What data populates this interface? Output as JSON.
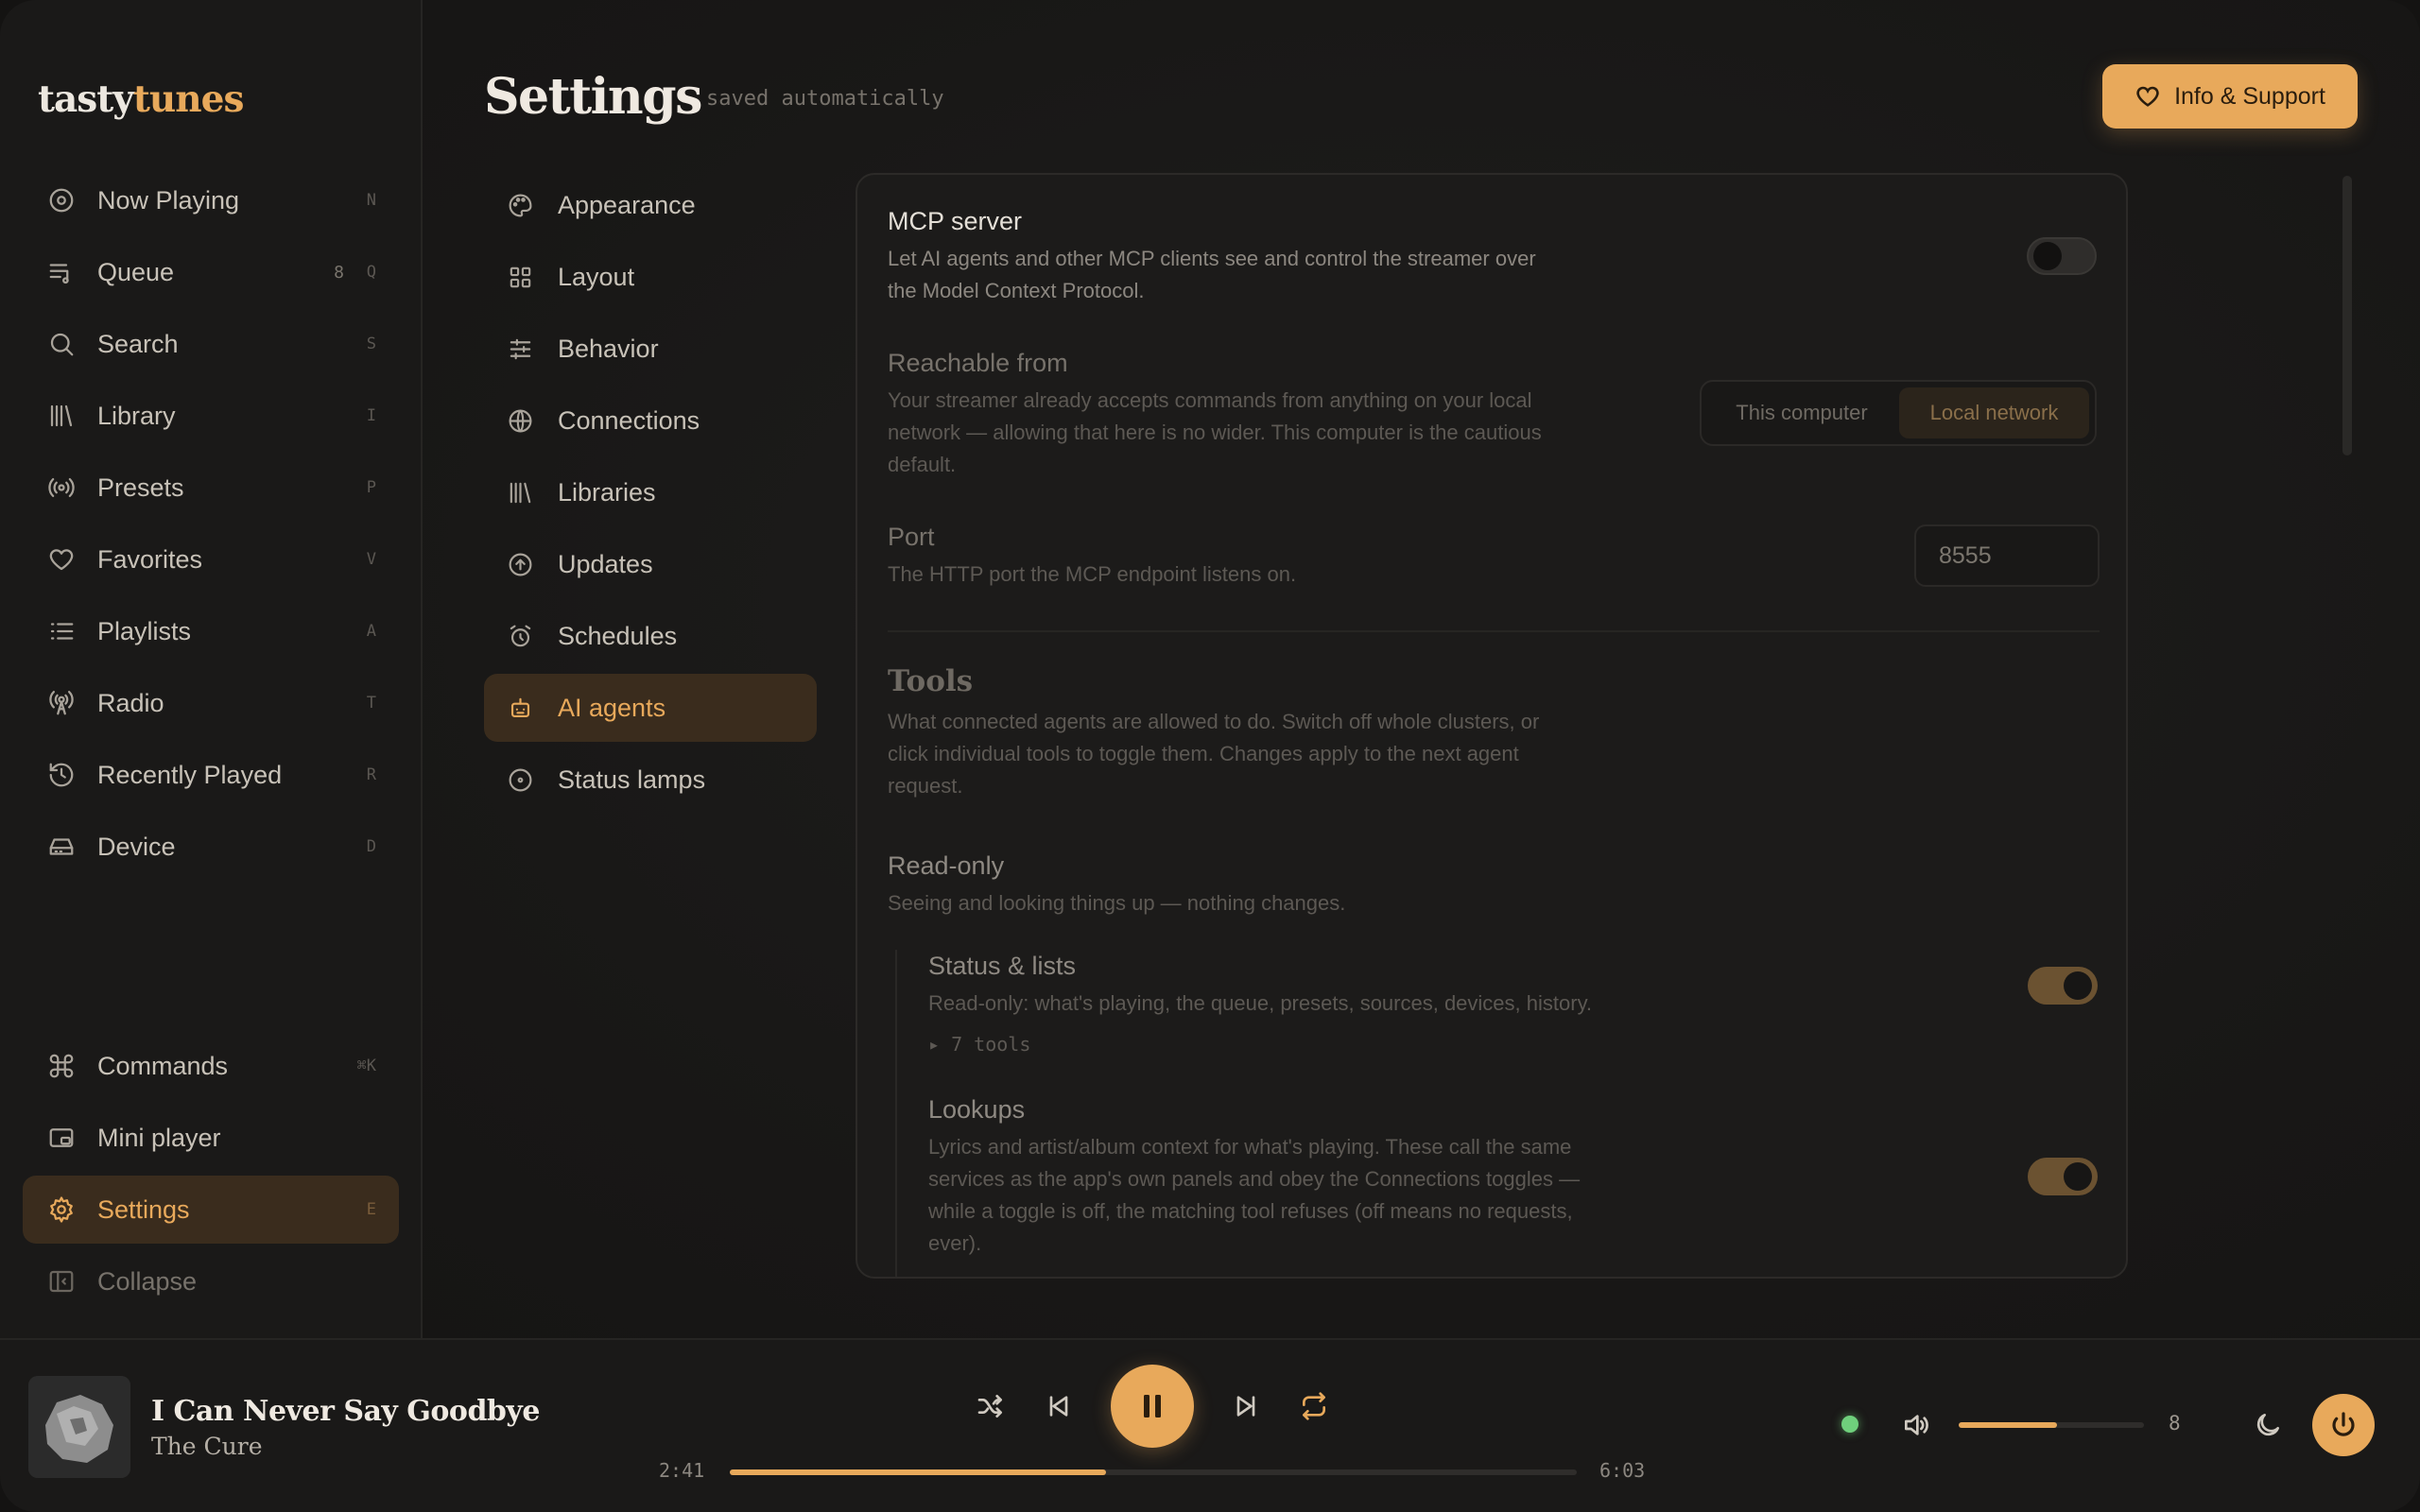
{
  "brand": {
    "part1": "tasty",
    "part2": "tunes"
  },
  "sidebar": {
    "items": [
      {
        "label": "Now Playing",
        "key": "N",
        "icon": "disc-icon"
      },
      {
        "label": "Queue",
        "key": "Q",
        "count": "8",
        "icon": "queue-icon"
      },
      {
        "label": "Search",
        "key": "S",
        "icon": "search-icon"
      },
      {
        "label": "Library",
        "key": "I",
        "icon": "library-icon"
      },
      {
        "label": "Presets",
        "key": "P",
        "icon": "broadcast-icon"
      },
      {
        "label": "Favorites",
        "key": "V",
        "icon": "heart-icon"
      },
      {
        "label": "Playlists",
        "key": "A",
        "icon": "list-icon"
      },
      {
        "label": "Radio",
        "key": "T",
        "icon": "radio-tower-icon"
      },
      {
        "label": "Recently Played",
        "key": "R",
        "icon": "history-icon"
      },
      {
        "label": "Device",
        "key": "D",
        "icon": "device-icon"
      }
    ],
    "bottom": [
      {
        "label": "Commands",
        "key": "⌘K",
        "icon": "command-icon"
      },
      {
        "label": "Mini player",
        "icon": "mini-player-icon"
      },
      {
        "label": "Settings",
        "key": "E",
        "icon": "gear-icon"
      },
      {
        "label": "Collapse",
        "icon": "collapse-icon"
      }
    ]
  },
  "header": {
    "title": "Settings",
    "subtitle": "saved automatically",
    "support_label": "Info & Support"
  },
  "settings_nav": [
    {
      "label": "Appearance",
      "icon": "palette-icon"
    },
    {
      "label": "Layout",
      "icon": "grid-icon"
    },
    {
      "label": "Behavior",
      "icon": "sliders-icon"
    },
    {
      "label": "Connections",
      "icon": "globe-icon"
    },
    {
      "label": "Libraries",
      "icon": "library-icon"
    },
    {
      "label": "Updates",
      "icon": "arrow-up-circle-icon"
    },
    {
      "label": "Schedules",
      "icon": "alarm-clock-icon"
    },
    {
      "label": "AI agents",
      "icon": "robot-icon"
    },
    {
      "label": "Status lamps",
      "icon": "lamp-icon"
    }
  ],
  "panel": {
    "mcp": {
      "title": "MCP server",
      "desc1": "Let AI agents and other MCP clients see and control the streamer over",
      "desc2": "the Model Context Protocol.",
      "enabled": false
    },
    "reachable": {
      "title": "Reachable from",
      "desc1": "Your streamer already accepts commands from anything on your local",
      "desc2": "network — allowing that here is no wider. This computer is the cautious",
      "desc3": "default.",
      "option_a": "This computer",
      "option_b": "Local network",
      "selected": "Local network"
    },
    "port": {
      "title": "Port",
      "desc": "The HTTP port the MCP endpoint listens on.",
      "value": "8555"
    },
    "tools": {
      "title": "Tools",
      "desc1": "What connected agents are allowed to do. Switch off whole clusters, or",
      "desc2": "click individual tools to toggle them. Changes apply to the next agent",
      "desc3": "request."
    },
    "readonly": {
      "title": "Read-only",
      "desc": "Seeing and looking things up — nothing changes."
    },
    "status_lists": {
      "title": "Status & lists",
      "desc": "Read-only: what's playing, the queue, presets, sources, devices, history.",
      "tools": "▸ 7 tools",
      "enabled": true
    },
    "lookups": {
      "title": "Lookups",
      "desc1": "Lyrics and artist/album context for what's playing. These call the same",
      "desc2": "services as the app's own panels and obey the Connections toggles —",
      "desc3": "while a toggle is off, the matching tool refuses (off means no requests,",
      "desc4": "ever).",
      "enabled": true
    }
  },
  "player": {
    "title": "I Can Never Say Goodbye",
    "artist": "The Cure",
    "elapsed": "2:41",
    "duration": "6:03",
    "progress": 0.444,
    "volume": 8,
    "volume_fraction": 0.53,
    "status_color": "#6fcf7c"
  },
  "colors": {
    "accent": "#e8a95b",
    "background": "#141312"
  }
}
